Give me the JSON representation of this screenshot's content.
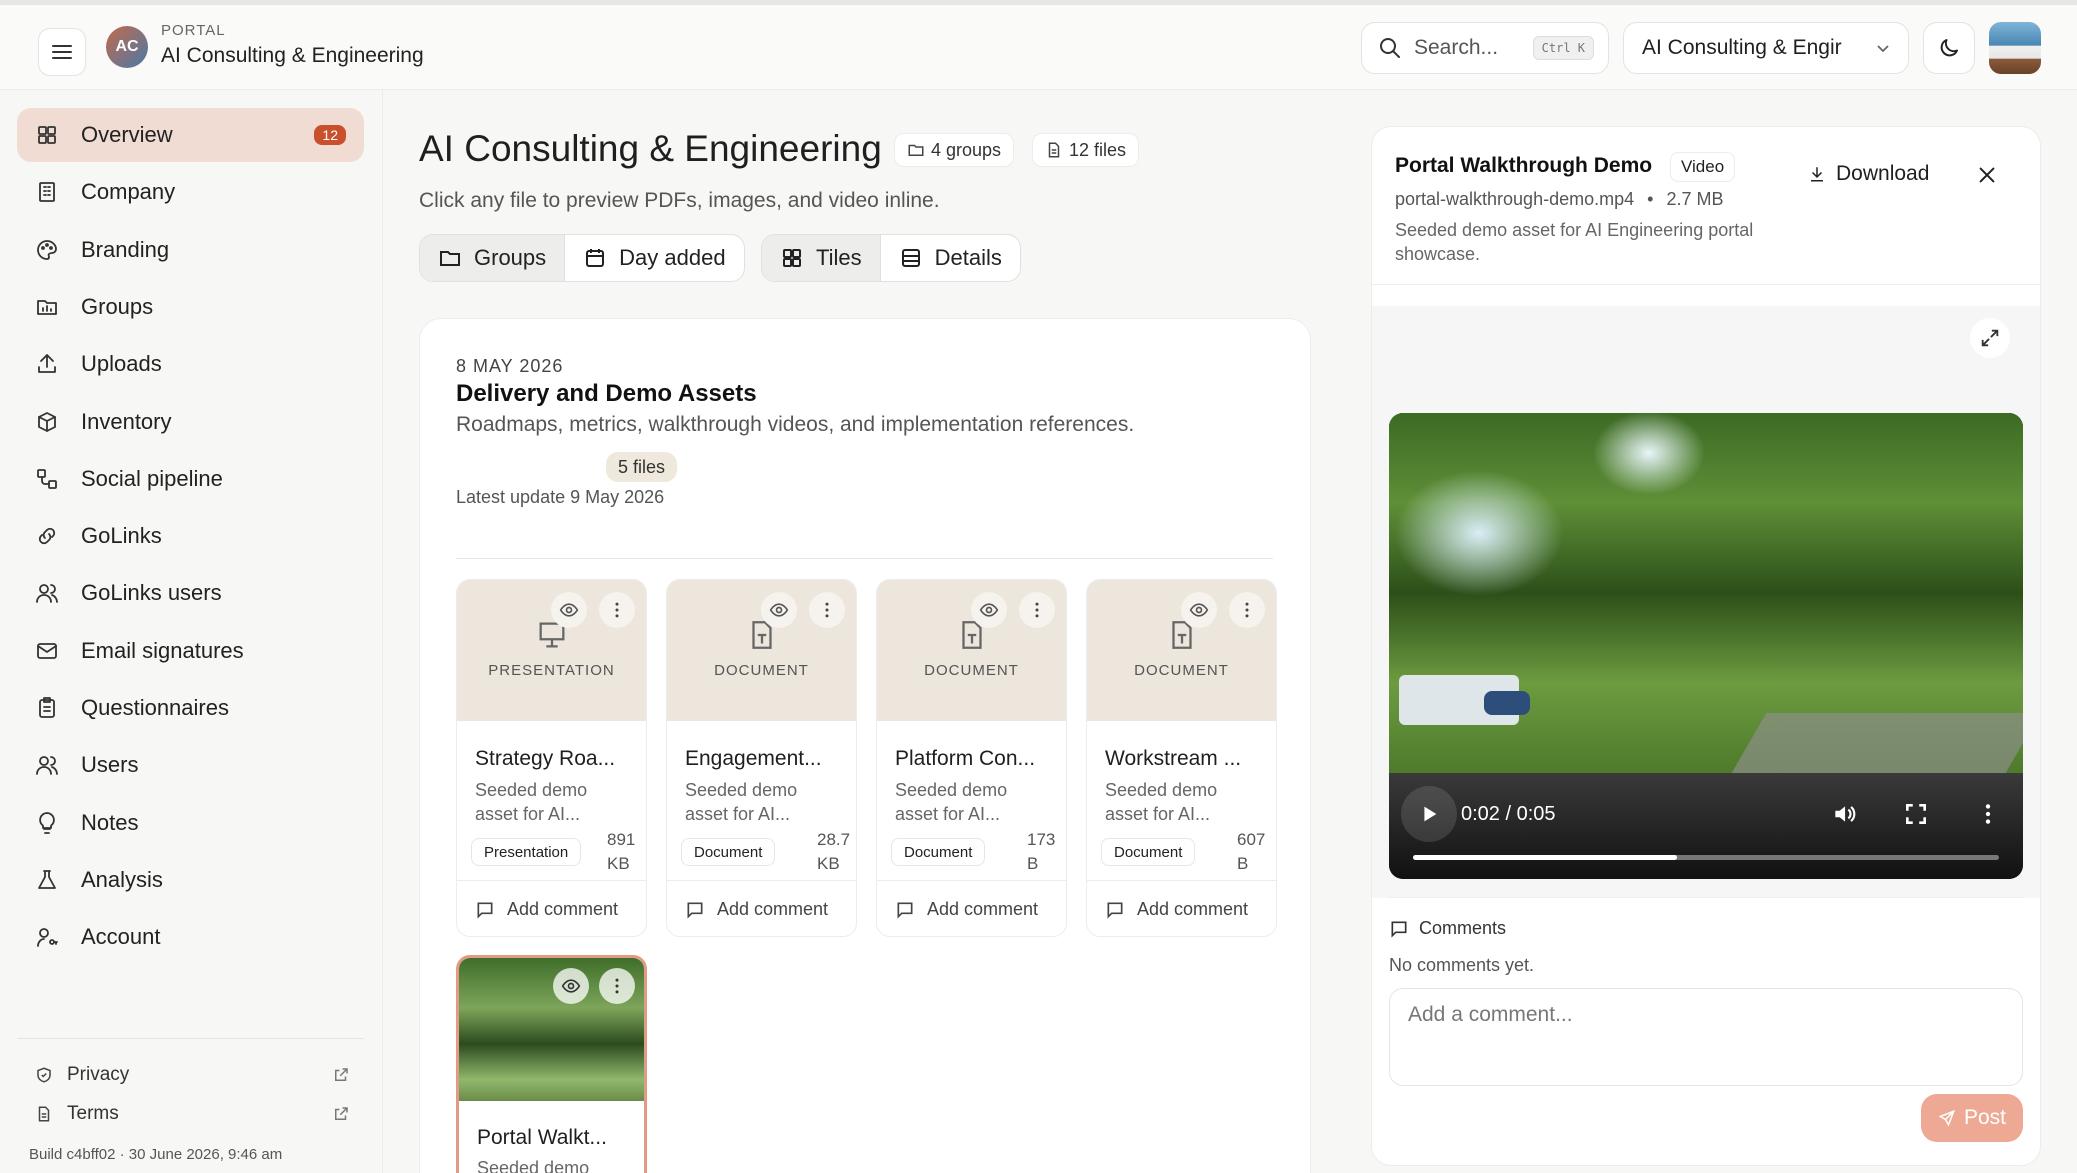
{
  "header": {
    "avatar_initials": "AC",
    "portal_label": "PORTAL",
    "portal_name": "AI Consulting & Engineering",
    "search_placeholder": "Search...",
    "search_shortcut": "Ctrl K",
    "workspace_select": "AI Consulting & Engir"
  },
  "sidebar": {
    "items": [
      {
        "label": "Overview",
        "icon": "grid-icon",
        "active": true,
        "badge": "12"
      },
      {
        "label": "Company",
        "icon": "building-icon"
      },
      {
        "label": "Branding",
        "icon": "palette-icon"
      },
      {
        "label": "Groups",
        "icon": "folder-chart-icon"
      },
      {
        "label": "Uploads",
        "icon": "upload-icon"
      },
      {
        "label": "Inventory",
        "icon": "package-icon"
      },
      {
        "label": "Social pipeline",
        "icon": "workflow-icon"
      },
      {
        "label": "GoLinks",
        "icon": "link-icon"
      },
      {
        "label": "GoLinks users",
        "icon": "users-icon"
      },
      {
        "label": "Email signatures",
        "icon": "mail-icon"
      },
      {
        "label": "Questionnaires",
        "icon": "clipboard-icon"
      },
      {
        "label": "Users",
        "icon": "users-icon"
      },
      {
        "label": "Notes",
        "icon": "lightbulb-icon"
      },
      {
        "label": "Analysis",
        "icon": "flask-icon"
      },
      {
        "label": "Account",
        "icon": "user-key-icon"
      }
    ],
    "footer": {
      "privacy": "Privacy",
      "terms": "Terms",
      "build": "Build c4bff02 · 30 June 2026, 9:46 am"
    }
  },
  "main": {
    "title": "AI Consulting & Engineering",
    "groups_count": "4 groups",
    "files_count": "12 files",
    "subtitle": "Click any file to preview PDFs, images, and video inline.",
    "view_groups": "Groups",
    "view_day": "Day added",
    "view_tiles": "Tiles",
    "view_details": "Details",
    "group": {
      "date": "8 MAY 2026",
      "title": "Delivery and Demo Assets",
      "description": "Roadmaps, metrics, walkthrough videos, and implementation references.",
      "files_chip": "5 files",
      "latest": "Latest update 9 May 2026",
      "tiles": [
        {
          "kind": "PRESENTATION",
          "name": "Strategy Roa...",
          "desc1": "Seeded demo",
          "desc2": "asset for AI...",
          "type": "Presentation",
          "size1": "891",
          "size2": "KB",
          "comment": "Add comment"
        },
        {
          "kind": "DOCUMENT",
          "name": "Engagement...",
          "desc1": "Seeded demo",
          "desc2": "asset for AI...",
          "type": "Document",
          "size1": "28.7",
          "size2": "KB",
          "comment": "Add comment"
        },
        {
          "kind": "DOCUMENT",
          "name": "Platform Con...",
          "desc1": "Seeded demo",
          "desc2": "asset for AI...",
          "type": "Document",
          "size1": "173",
          "size2": "B",
          "comment": "Add comment"
        },
        {
          "kind": "DOCUMENT",
          "name": "Workstream ...",
          "desc1": "Seeded demo",
          "desc2": "asset for AI...",
          "type": "Document",
          "size1": "607",
          "size2": "B",
          "comment": "Add comment"
        }
      ],
      "video_tile": {
        "name": "Portal Walkt...",
        "desc": "Seeded demo"
      }
    }
  },
  "preview": {
    "title": "Portal Walkthrough Demo",
    "type": "Video",
    "filename": "portal-walkthrough-demo.mp4",
    "bullet": "•",
    "size": "2.7 MB",
    "description": "Seeded demo asset for AI Engineering portal showcase.",
    "download": "Download",
    "video_time": "0:02 / 0:05",
    "progress": 0.45,
    "comments_label": "Comments",
    "no_comments": "No comments yet.",
    "comment_placeholder": "Add a comment...",
    "post": "Post"
  },
  "colors": {
    "accent": "#c9502c",
    "active_bg": "#f0dcd3",
    "post_bg": "#eea995",
    "thumb_bg": "#ece6dc"
  }
}
